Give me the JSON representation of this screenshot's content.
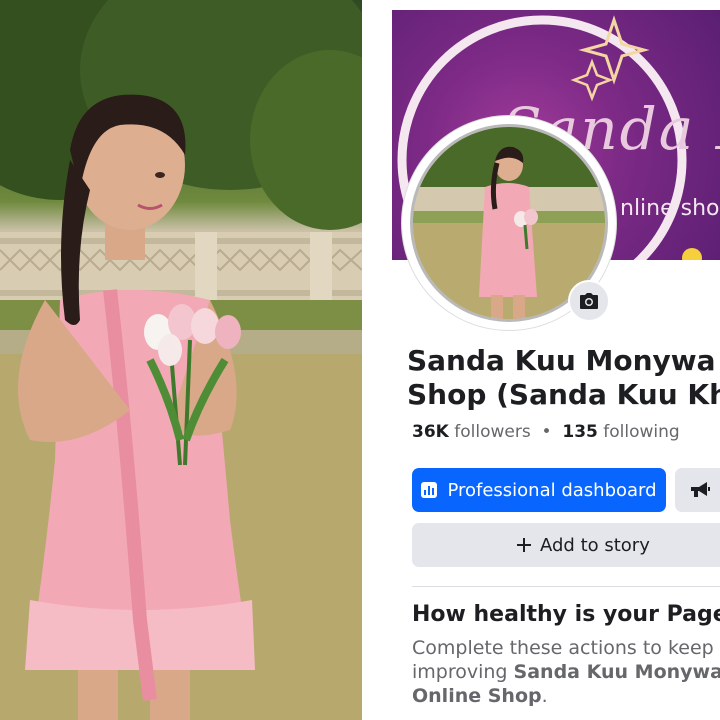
{
  "profile": {
    "cover_text": "Sanda Ku",
    "cover_subtext": "nline sho",
    "page_name_line1": "Sanda Kuu Monywa Onl",
    "page_name_line2": "Shop (Sanda Kuu Khin)",
    "followers_count": "36K",
    "followers_label": "followers",
    "separator": "•",
    "following_count": "135",
    "following_label": "following"
  },
  "actions": {
    "professional_dashboard": "Professional dashboard",
    "add_to_story": "Add to story"
  },
  "health": {
    "title": "How healthy is your Page?",
    "body_prefix": "Complete these actions to keep improving ",
    "body_page_name": "Sanda Kuu Monywa Online Shop",
    "body_suffix": "."
  },
  "icons": {
    "camera": "camera-icon",
    "dashboard": "bar-chart-icon",
    "promote": "megaphone-icon",
    "add": "plus-icon"
  },
  "colors": {
    "primary_button": "#0866ff",
    "secondary_button": "#e4e6eb",
    "cover_purple": "#7d2a86",
    "dress_pink": "#f2a9b5"
  }
}
